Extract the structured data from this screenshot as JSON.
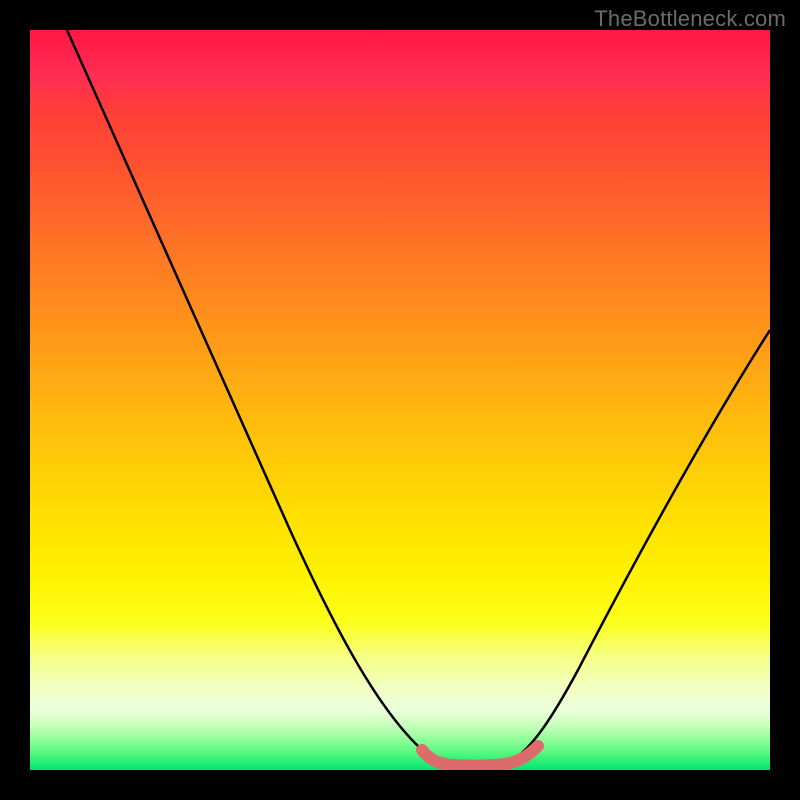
{
  "watermark": "TheBottleneck.com",
  "colors": {
    "background": "#000000",
    "gradient_top": "#ff1744",
    "gradient_mid": "#ffe000",
    "gradient_bottom": "#00e676",
    "curve_stroke": "#000000",
    "flat_bottom_stroke": "#e06868"
  },
  "chart_data": {
    "type": "line",
    "title": "",
    "xlabel": "",
    "ylabel": "",
    "xlim": [
      0,
      100
    ],
    "ylim": [
      0,
      100
    ],
    "x": [
      5,
      10,
      15,
      20,
      25,
      30,
      35,
      40,
      45,
      48,
      50,
      55,
      58,
      62,
      65,
      68,
      72,
      76,
      80,
      85,
      90,
      95,
      100
    ],
    "values": [
      100,
      90,
      80,
      70,
      60,
      50,
      40,
      30,
      19,
      12,
      8,
      2,
      0,
      0,
      0,
      2,
      8,
      15,
      22,
      31,
      40,
      49,
      58
    ],
    "flat_bottom": {
      "x_range": [
        55,
        70
      ],
      "y": 1.5,
      "note": "thick salmon segment at curve minimum"
    }
  }
}
